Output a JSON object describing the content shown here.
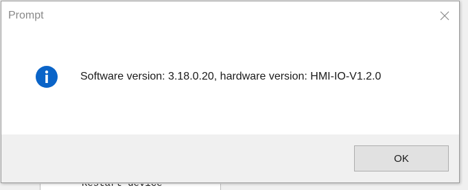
{
  "dialog": {
    "title": "Prompt",
    "message": "Software version: 3.18.0.20, hardware version: HMI-IO-V1.2.0",
    "icon": "info-icon",
    "ok_label": "OK",
    "close_icon": "close-icon"
  },
  "background_window": {
    "partial_text": "Restart device"
  },
  "colors": {
    "info_icon_fill": "#0a64c8",
    "footer_background": "#f0f0f0",
    "button_background": "#e1e1e1"
  }
}
